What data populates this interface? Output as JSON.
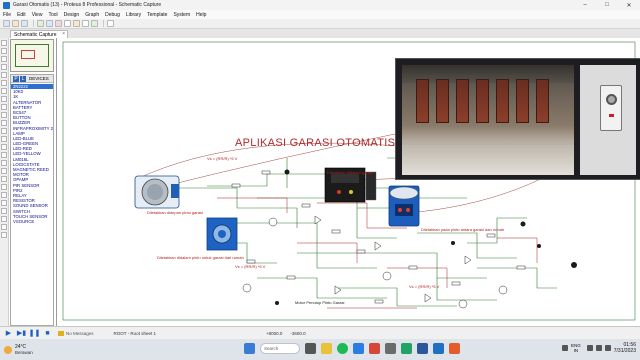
{
  "window": {
    "title": "Garasi Otomatis (13) - Proteus 8 Professional - Schematic Capture"
  },
  "menu": [
    "File",
    "Edit",
    "View",
    "Tool",
    "Design",
    "Graph",
    "Debug",
    "Library",
    "Template",
    "System",
    "Help"
  ],
  "tab": {
    "label": "Schematic Capture",
    "close": "×"
  },
  "device_panel": {
    "header_p": "P",
    "header_l": "L",
    "header_label": "DEVICES",
    "items": [
      "2N2222",
      "10K0",
      "1K",
      "ALTERNATOR",
      "BATTERY",
      "BC547",
      "BUTTON",
      "BUZZER",
      "INFRAPROXIMITY 2",
      "LAMP",
      "LED-BLUE",
      "LED-GREEN",
      "LED-RED",
      "LED-YELLOW",
      "LM016L",
      "LOGICSTATE",
      "MAGNETIC REED",
      "MOTOR",
      "OPAMP",
      "PIR SENSOR",
      "PIR2",
      "RELAY",
      "RESISTOR",
      "SOUND SENSOR",
      "SWITCH",
      "TOUCH SENSOR",
      "VSOURCE"
    ],
    "selected_index": 0
  },
  "schematic": {
    "title": "APLIKASI GARASI OTOMATIS",
    "notes": [
      "Vs = (RR/R) *5 V",
      "Diletakkan didepan pintu garasi",
      "Diletakkan didalam pintu untuk garasi dari rumah",
      "Diletakkan pada pintu antara garasi dan rumah",
      "Vs = (RR/R) *5 V",
      "Motor Penutup Pintu Garasi",
      "Vs = (RR/R) *5 V",
      "Diletakkan didalam garasi"
    ]
  },
  "statusbar": {
    "messages": "No Messages",
    "root": "ROOT - Root sheet 1",
    "coord_x": "+8000.0",
    "coord_y": "-3600.0"
  },
  "taskbar": {
    "temperature": "24°C",
    "condition": "Berawan",
    "search": "Search",
    "lang_line1": "ENG",
    "lang_line2": "IN",
    "time": "01:56",
    "date": "7/31/2023"
  },
  "colors": {
    "title_red": "#b02b2b",
    "wire_red": "#a52020",
    "wire_green": "#2d7b2d",
    "selected_blue": "#2f6fd0"
  }
}
